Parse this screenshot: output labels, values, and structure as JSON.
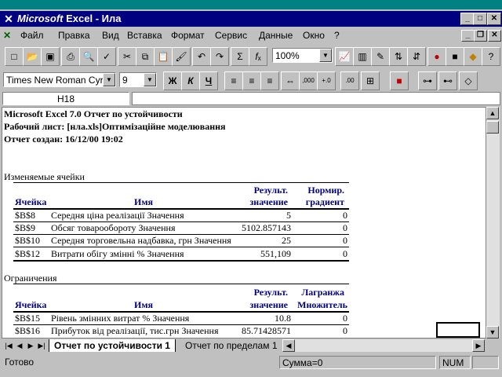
{
  "window": {
    "title": "Microsoft Excel - Ила",
    "title_app": "Microsoft",
    "title_rest": " Excel - Ила"
  },
  "menu": [
    "Файл",
    "Правка",
    "Вид",
    "Вставка",
    "Формат",
    "Сервис",
    "Данные",
    "Окно",
    "?"
  ],
  "toolbar": {
    "zoom": "100%"
  },
  "format_bar": {
    "font": "Times New Roman Cyr",
    "size": "9",
    "bold": "Ж",
    "italic": "К",
    "underline": "Ч"
  },
  "formula_bar": {
    "name_box": "H18",
    "content": ""
  },
  "report": {
    "line1": "Microsoft Excel 7.0 Отчет по устойчивости",
    "line2": "Рабочий лист: [нла.xls]Оптимізаційне моделювання",
    "line3": "Отчет создан: 16/12/00 19:02",
    "section1": {
      "title": "Изменяемые ячейки",
      "headers": {
        "cell": "Ячейка",
        "name": "Имя",
        "value1": "Результ.",
        "value2": "значение",
        "grad1": "Нормир.",
        "grad2": "градиент"
      },
      "rows": [
        {
          "cell": "$B$8",
          "name": "Середня ціна реалізації Значення",
          "value": "5",
          "grad": "0"
        },
        {
          "cell": "$B$9",
          "name": "Обсяг товарообороту Значення",
          "value": "5102.857143",
          "grad": "0"
        },
        {
          "cell": "$B$10",
          "name": "Середня торговельна надбавка, грн Значення",
          "value": "25",
          "grad": "0"
        },
        {
          "cell": "$B$12",
          "name": "Витрати обігу змінні % Значення",
          "value": "551,109",
          "grad": "0"
        }
      ]
    },
    "section2": {
      "title": "Ограничения",
      "headers": {
        "cell": "Ячейка",
        "name": "Имя",
        "value1": "Результ.",
        "value2": "значение",
        "lag1": "Лагранжа",
        "lag2": "Множитель"
      },
      "rows": [
        {
          "cell": "$B$15",
          "name": "Рівень змінних витрат % Значення",
          "value": "10.8",
          "lag": "0"
        },
        {
          "cell": "$B$16",
          "name": "Прибуток від реалізації, тис.грн Значення",
          "value": "85.71428571",
          "lag": "0"
        }
      ]
    }
  },
  "tabs": {
    "active": "Отчет по устойчивости 1",
    "inactive": "Отчет по пределам 1"
  },
  "status": {
    "ready": "Готово",
    "sum": "Сумма=0",
    "num": "NUM"
  }
}
